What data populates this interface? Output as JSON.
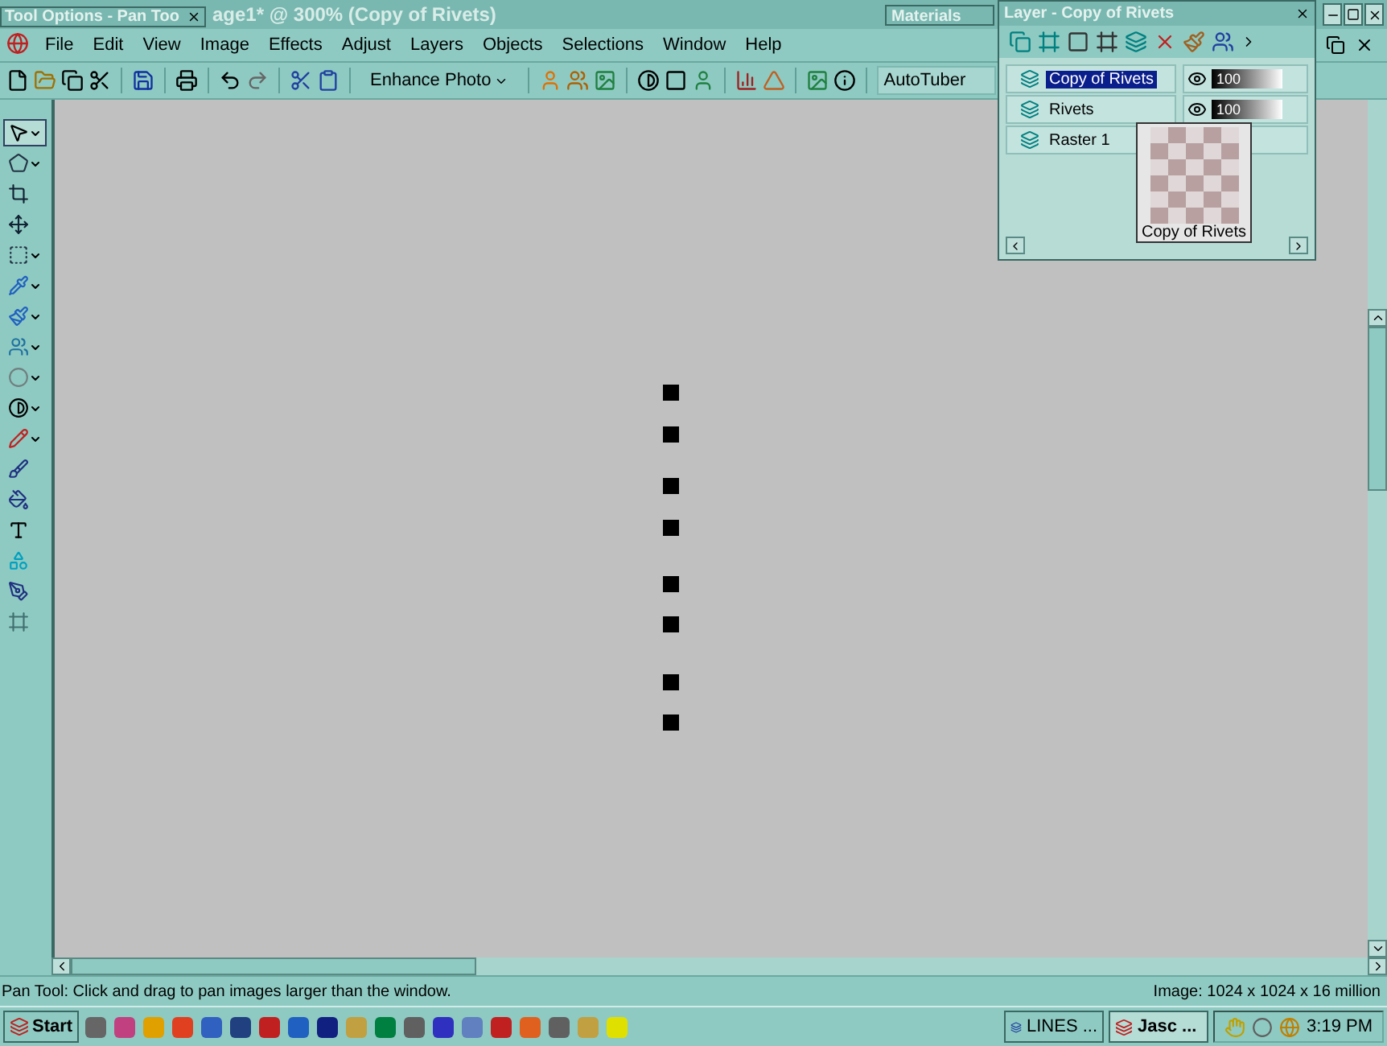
{
  "window": {
    "title": "age1* @ 300% (Copy of Rivets)"
  },
  "tool_options": {
    "title": "Tool Options - Pan Too"
  },
  "materials": {
    "title": "Materials"
  },
  "menu": [
    "File",
    "Edit",
    "View",
    "Image",
    "Effects",
    "Adjust",
    "Layers",
    "Objects",
    "Selections",
    "Window",
    "Help"
  ],
  "toolbar": {
    "enhance_button": "Enhance Photo",
    "preset_field": "AutoTuber"
  },
  "tools": [
    {
      "selected": true,
      "menu": true
    },
    {
      "selected": false,
      "menu": true
    },
    {
      "selected": false,
      "menu": false
    },
    {
      "selected": false,
      "menu": false
    },
    {
      "selected": false,
      "menu": true
    },
    {
      "selected": false,
      "menu": true
    },
    {
      "selected": false,
      "menu": true
    },
    {
      "selected": false,
      "menu": true
    },
    {
      "selected": false,
      "menu": true
    },
    {
      "selected": false,
      "menu": true
    },
    {
      "selected": false,
      "menu": true
    },
    {
      "selected": false,
      "menu": false
    },
    {
      "selected": false,
      "menu": false
    },
    {
      "selected": false,
      "menu": false
    },
    {
      "selected": false,
      "menu": false
    },
    {
      "selected": false,
      "menu": false
    },
    {
      "selected": false,
      "menu": false
    }
  ],
  "layer_palette": {
    "title": "Layer - Copy of Rivets",
    "layers": [
      {
        "name": "Copy of Rivets",
        "selected": true,
        "opacity": "100",
        "level": 1
      },
      {
        "name": "Rivets",
        "selected": false,
        "opacity": "100",
        "level": 1
      },
      {
        "name": "Raster 1",
        "selected": false
      }
    ],
    "tooltip": "Copy of Rivets"
  },
  "status_bar": {
    "hint": "Pan Tool: Click and drag to pan images larger than the window.",
    "image_info": "Image:  1024 x 1024 x 16 million"
  },
  "taskbar": {
    "start": "Start",
    "tasks": [
      {
        "label": "LINES ...",
        "selected": false
      },
      {
        "label": "Jasc ...",
        "selected": true
      }
    ],
    "clock": "3:19 PM"
  }
}
